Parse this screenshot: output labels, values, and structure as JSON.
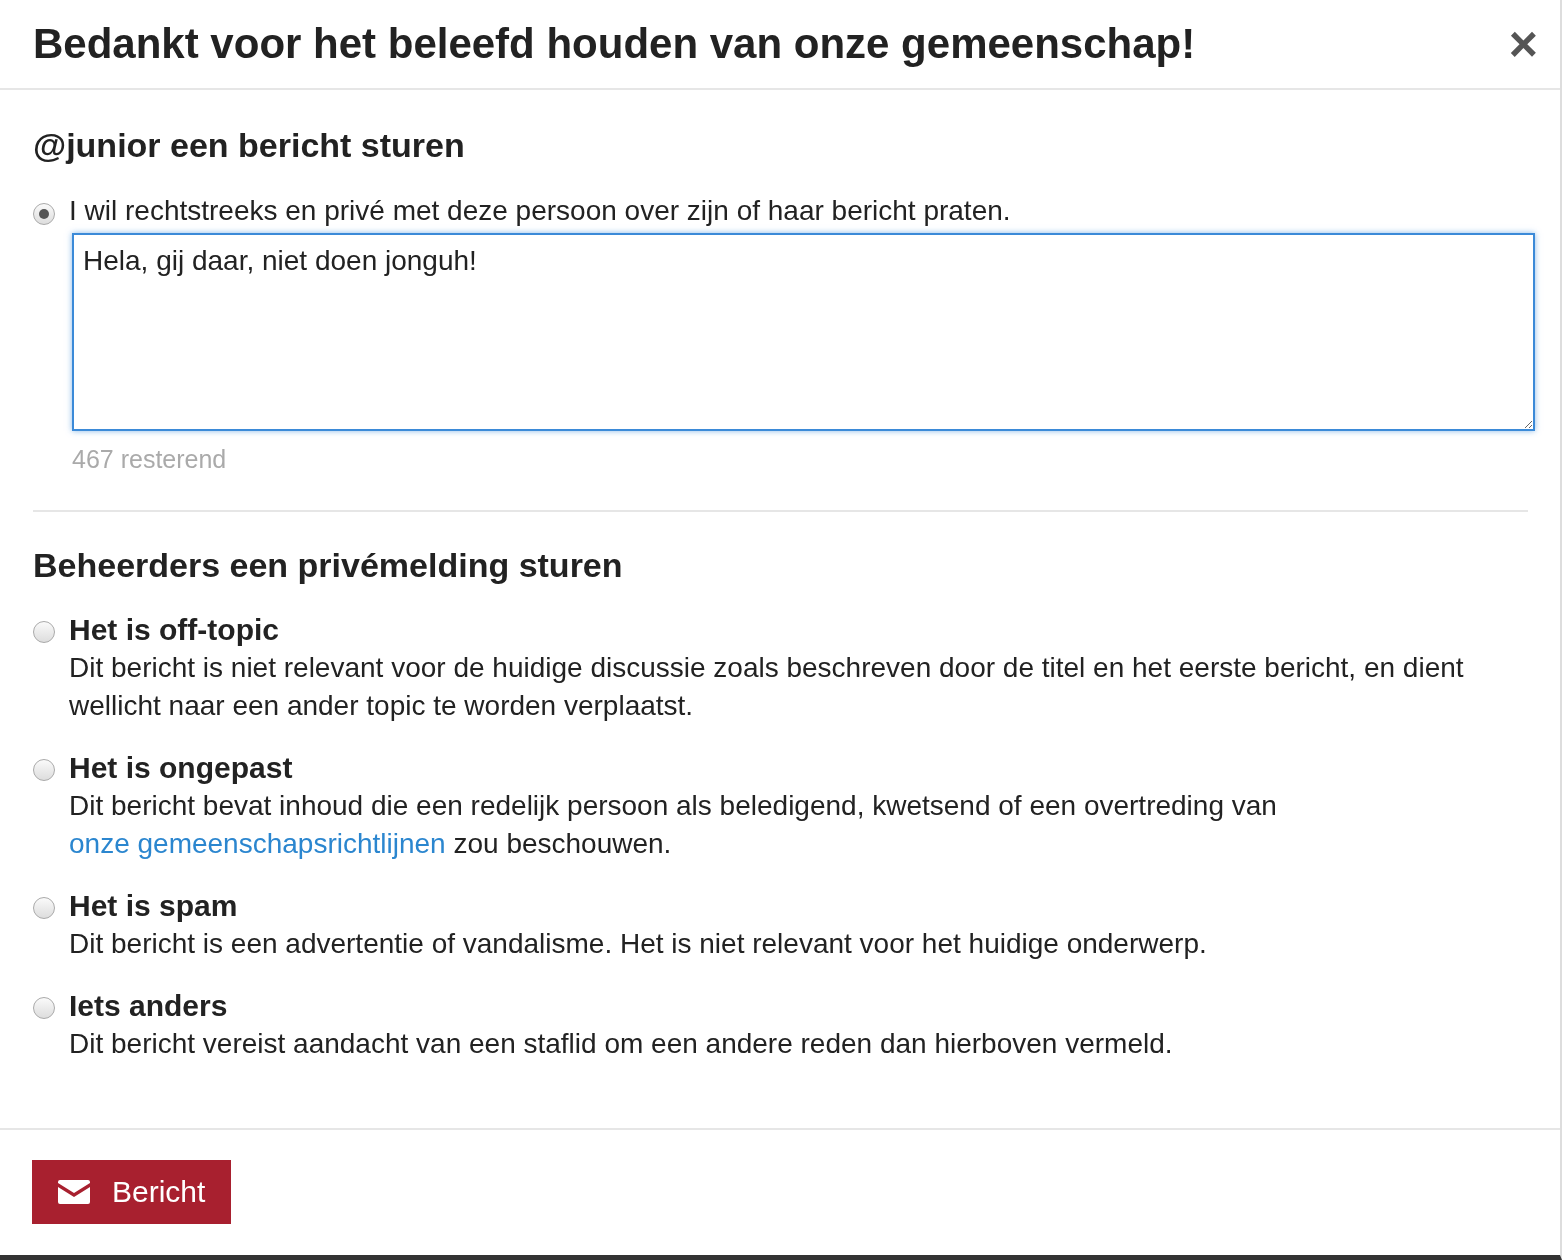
{
  "dialog": {
    "title": "Bedankt voor het beleefd houden van onze gemeenschap!",
    "close": "×"
  },
  "message_section": {
    "heading": "@junior een bericht sturen",
    "option": {
      "label": "I wil rechtstreeks en privé met deze persoon over zijn of haar bericht praten.",
      "selected": true
    },
    "message": "Hela, gij daar, niet doen jonguh!",
    "remaining": "467 resterend"
  },
  "flag_section": {
    "heading": "Beheerders een privémelding sturen",
    "options": [
      {
        "title": "Het is off-topic",
        "description": "Dit bericht is niet relevant voor de huidige discussie zoals beschreven door de titel en het eerste bericht, en dient wellicht naar een ander topic te worden verplaatst.",
        "selected": false
      },
      {
        "title": "Het is ongepast",
        "description": "Dit bericht bevat inhoud die een redelijk persoon als beledigend, kwetsend of een overtreding van",
        "link": "onze gemeenschapsrichtlijnen",
        "description_after": "zou beschouwen.",
        "selected": false
      },
      {
        "title": "Het is spam",
        "description": "Dit bericht is een advertentie of vandalisme. Het is niet relevant voor het huidige onderwerp.",
        "selected": false
      },
      {
        "title": "Iets anders",
        "description": "Dit bericht vereist aandacht van een staflid om een andere reden dan hierboven vermeld.",
        "selected": false
      }
    ]
  },
  "footer": {
    "button": "Bericht"
  }
}
